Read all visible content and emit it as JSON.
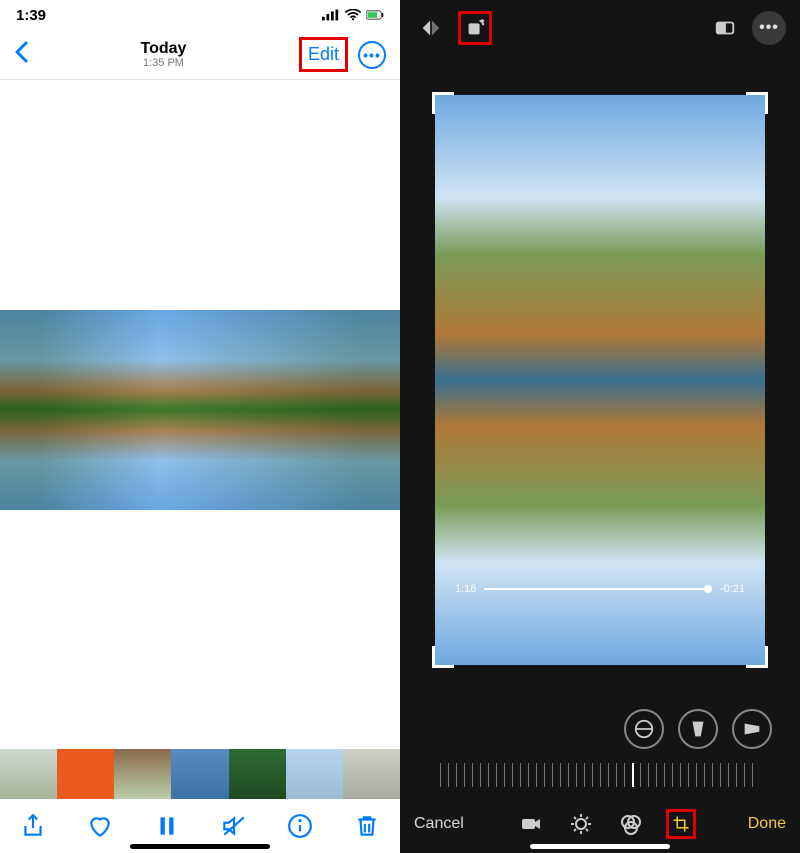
{
  "status": {
    "time": "1:39"
  },
  "nav": {
    "title": "Today",
    "subtitle": "1:35 PM",
    "edit": "Edit"
  },
  "timeline": {
    "elapsed": "1:16",
    "remaining": "-0:21"
  },
  "editor": {
    "cancel": "Cancel",
    "done": "Done"
  },
  "icons": {
    "back": "back-chevron",
    "more": "more-ellipsis",
    "share": "share-icon",
    "favorite": "heart-icon",
    "pause": "pause-icon",
    "mute": "mute-icon",
    "info": "info-icon",
    "delete": "trash-icon",
    "flip_h": "flip-horizontal-icon",
    "rotate": "rotate-icon",
    "aspect": "aspect-ratio-icon",
    "more_dark": "more-ellipsis-dark",
    "straighten": "straighten-icon",
    "skew_h": "horizontal-perspective-icon",
    "skew_v": "vertical-perspective-icon",
    "tab_video": "video-tab-icon",
    "tab_adjust": "adjust-tab-icon",
    "tab_filters": "filters-tab-icon",
    "tab_crop": "crop-tab-icon"
  },
  "colors": {
    "accent_blue": "#007aff",
    "accent_yellow": "#f5c940",
    "highlight_red": "#e00000"
  }
}
